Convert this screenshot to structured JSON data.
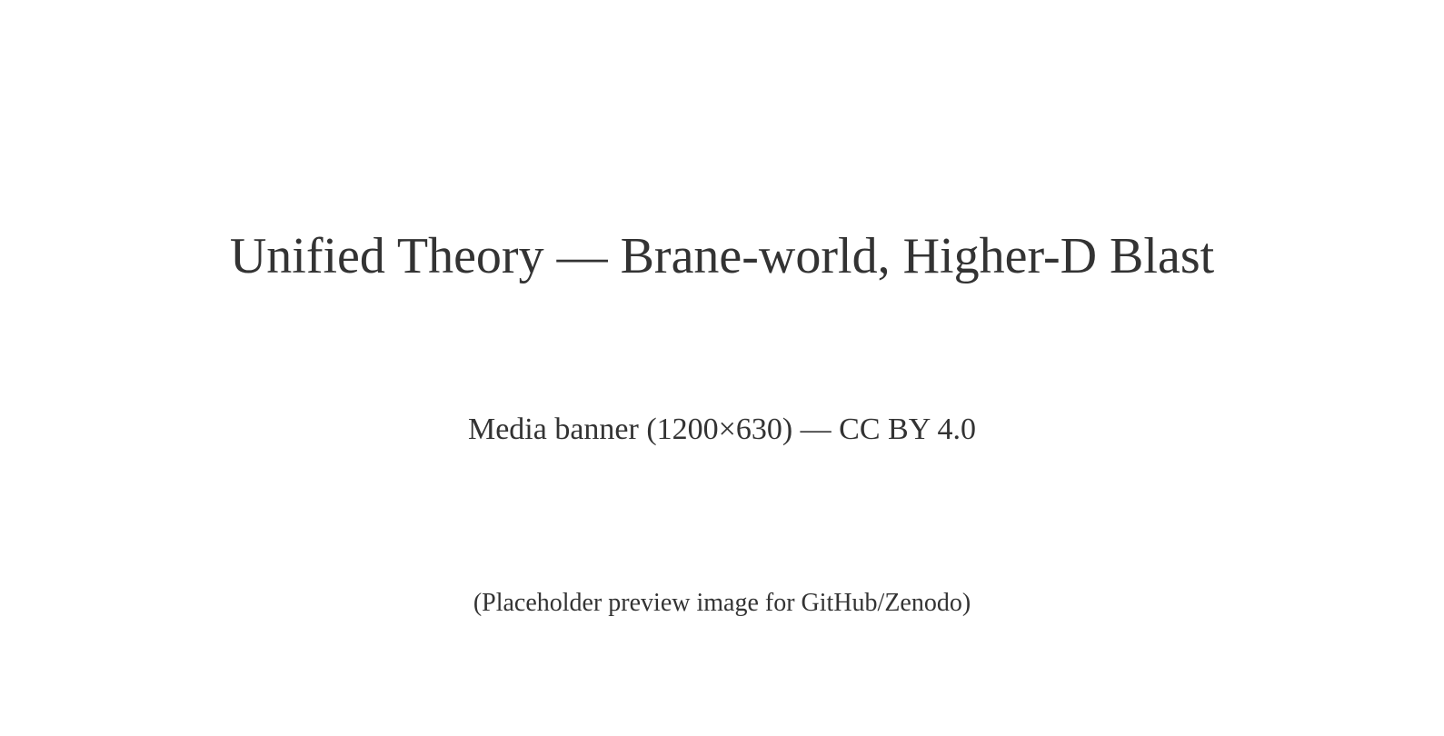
{
  "banner": {
    "title": "Unified Theory — Brane-world, Higher-D Blast",
    "subtitle": "Media banner (1200×630) — CC BY 4.0",
    "note": "(Placeholder preview image for GitHub/Zenodo)",
    "text_color": "#333333",
    "background_color": "#ffffff"
  }
}
